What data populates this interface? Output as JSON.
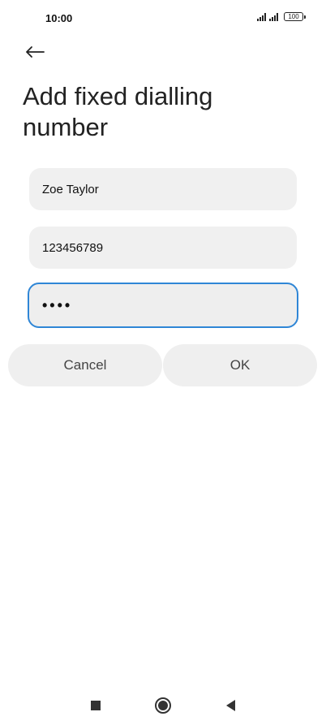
{
  "status_bar": {
    "time": "10:00",
    "battery": "100"
  },
  "header": {
    "back_icon": "arrow-left-icon",
    "title": "Add fixed dialling number"
  },
  "form": {
    "name_value": "Zoe Taylor",
    "number_value": "123456789",
    "pin_value": "••••",
    "focus_color": "#2f86d6"
  },
  "actions": {
    "cancel_label": "Cancel",
    "ok_label": "OK"
  },
  "nav_bar": {
    "icons": [
      "square-recents-icon",
      "circle-home-icon",
      "triangle-back-icon"
    ]
  }
}
